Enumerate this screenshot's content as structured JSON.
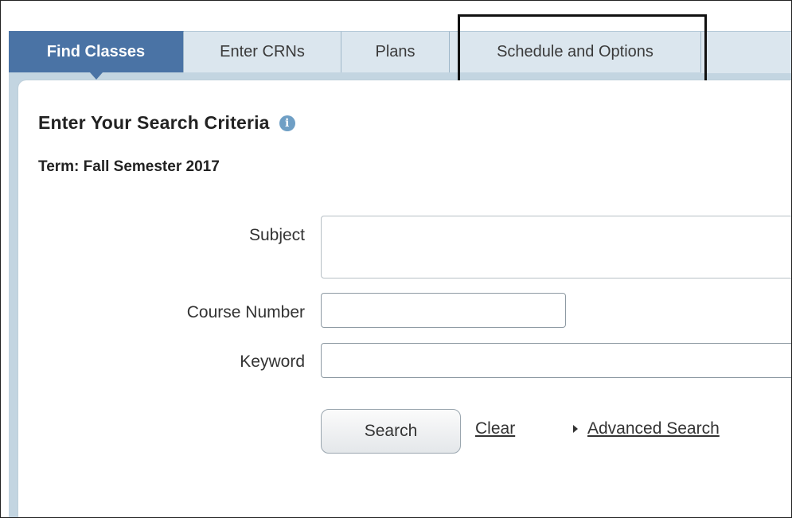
{
  "tabs": [
    {
      "label": "Find Classes",
      "active": true
    },
    {
      "label": "Enter CRNs",
      "active": false
    },
    {
      "label": "Plans",
      "active": false
    },
    {
      "label": "Schedule and Options",
      "active": false
    }
  ],
  "page": {
    "title": "Enter Your Search Criteria",
    "info_icon": "info-icon",
    "term": "Term: Fall Semester 2017"
  },
  "form": {
    "subject_label": "Subject",
    "subject_value": "",
    "course_number_label": "Course Number",
    "course_number_value": "",
    "keyword_label": "Keyword",
    "keyword_value": ""
  },
  "actions": {
    "search_label": "Search",
    "clear_label": "Clear",
    "advanced_label": "Advanced Search"
  },
  "colors": {
    "active_tab": "#4a73a5",
    "tab_background": "#dbe6ee",
    "shell_background": "#c3d5e1",
    "info_icon": "#6f9fc5"
  }
}
